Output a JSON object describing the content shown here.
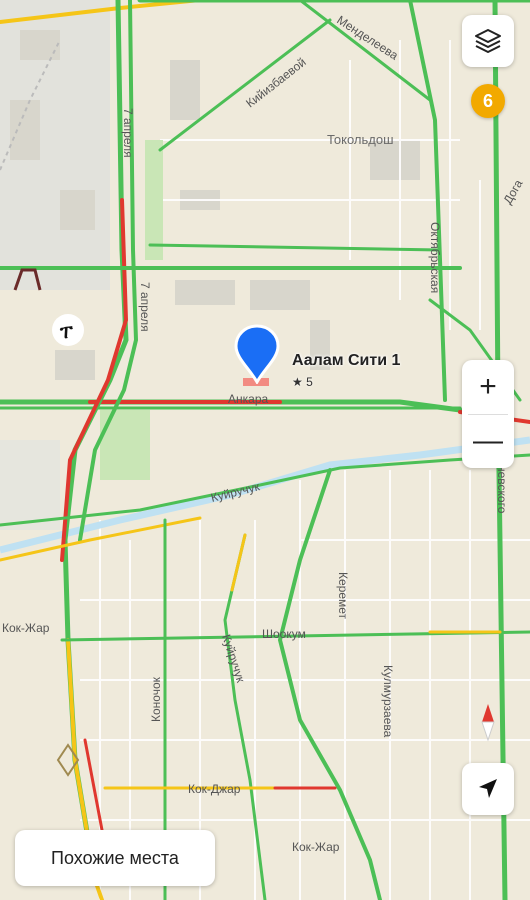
{
  "map": {
    "streets": {
      "mendeleeva": "Менделеева",
      "kiyizbaevoi": "Кийизбаевой",
      "aprelya_top": "7 апреля",
      "aprelya_mid": "7 апреля",
      "oktyabrskaya": "Октябрьская",
      "ankara": "Анкара",
      "kuiruchuk": "Куйручук",
      "kuiruchuk_vert": "Куйручук",
      "kok_zhar_left": "Кок-Жар",
      "kok_dzhar": "Кок-Джар",
      "kok_zhar_bottom": "Кок-Жар",
      "keremet": "Керемет",
      "shookum": "Шоокум",
      "konorchok": "Коночок",
      "kulmurzaeva": "Кулмурзаева",
      "pobedy_frag": "невского",
      "right_top_frag": "Дога"
    },
    "districts": {
      "tokoldosh": "Токольдош"
    },
    "colors": {
      "road_free": "#4cbf56",
      "road_slow": "#f5c518",
      "road_jam": "#e0382f",
      "background": "#efeadb"
    }
  },
  "poi": {
    "name": "Аалам Сити 1",
    "rating": "★ 5",
    "pin_color": "#1a6ef5"
  },
  "controls": {
    "layers_icon": "layers-icon",
    "badge_count": "6",
    "zoom_in": "+",
    "zoom_out": "—",
    "compass_icon": "compass-icon",
    "locate_icon": "navigation-arrow-icon"
  },
  "bottom": {
    "similar_places": "Похожие места"
  }
}
